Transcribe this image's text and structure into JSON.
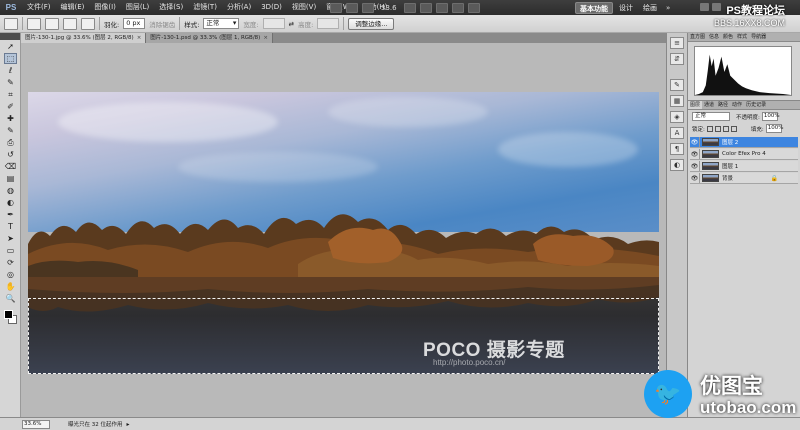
{
  "app": {
    "logo": "PS"
  },
  "menu": [
    "文件(F)",
    "编辑(E)",
    "图像(I)",
    "图层(L)",
    "选择(S)",
    "滤镜(T)",
    "分析(A)",
    "3D(D)",
    "视图(V)",
    "窗口(W)",
    "帮助(H)"
  ],
  "menubar": {
    "zoom": "33.6",
    "workspaces": [
      "基本功能",
      "设计",
      "绘画"
    ],
    "active_workspace": "基本功能",
    "more": "»"
  },
  "options": {
    "feather_label": "羽化:",
    "feather_value": "0 px",
    "antialias_label": "消除锯齿",
    "style_label": "样式:",
    "style_value": "正常",
    "width_label": "宽度:",
    "height_label": "高度:",
    "refine_button": "调整边缘..."
  },
  "doc_tabs": [
    {
      "label": "图片-130-1.jpg @ 33.6% (图层 2, RGB/8)",
      "active": true,
      "close": "×"
    },
    {
      "label": "图片-130-1.psd @ 33.3% (图层 1, RGB/8)",
      "active": false,
      "close": "×"
    }
  ],
  "tools": [
    "move-tool",
    "marquee-tool",
    "lasso-tool",
    "quick-select-tool",
    "crop-tool",
    "eyedropper-tool",
    "healing-tool",
    "brush-tool",
    "clone-stamp-tool",
    "history-brush-tool",
    "eraser-tool",
    "gradient-tool",
    "blur-tool",
    "dodge-tool",
    "pen-tool",
    "type-tool",
    "path-select-tool",
    "shape-tool",
    "3d-rotate-tool",
    "3d-orbit-tool",
    "hand-tool",
    "zoom-tool"
  ],
  "tool_glyphs": [
    "➚",
    "⬚",
    "ℓ",
    "✎",
    "⌗",
    "✐",
    "✚",
    "✎",
    "⎙",
    "↺",
    "⌫",
    "▤",
    "◍",
    "◐",
    "✒",
    "T",
    "➤",
    "▭",
    "⟳",
    "◎",
    "✋",
    "🔍"
  ],
  "active_tool": 1,
  "panel_strip_icons": [
    "≡",
    "⇵",
    "✎",
    "▦",
    "◈",
    "A",
    "¶",
    "◐"
  ],
  "histogram_panel": {
    "tabs": [
      "直方图",
      "信息",
      "颜色",
      "样式",
      "导航器"
    ],
    "active_tab": 0
  },
  "layers_panel": {
    "tabs": [
      "图层",
      "通道",
      "路径",
      "动作",
      "历史记录"
    ],
    "active_tab": 0,
    "blend_mode": "正常",
    "opacity_label": "不透明度:",
    "opacity_value": "100%",
    "lock_label": "锁定:",
    "fill_label": "填充:",
    "fill_value": "100%",
    "layers": [
      {
        "name": "图层 2",
        "selected": true,
        "visible": true,
        "eye": "👁",
        "lock": ""
      },
      {
        "name": "Color Efex Pro 4",
        "selected": false,
        "visible": true,
        "eye": "👁",
        "lock": ""
      },
      {
        "name": "图层 1",
        "selected": false,
        "visible": true,
        "eye": "👁",
        "lock": ""
      },
      {
        "name": "背景",
        "selected": false,
        "visible": true,
        "eye": "👁",
        "lock": "🔒"
      }
    ]
  },
  "status": {
    "zoom": "33.6%",
    "info": "曝光只在 32 位起作用",
    "arrow": "▸"
  },
  "canvas": {
    "watermark": "POCO 摄影专题",
    "watermark_url": "http://photo.poco.cn/"
  },
  "site_watermarks": {
    "top_line1": "PS教程论坛",
    "top_line2": "BBS.16XX8.COM",
    "bottom_cn": "优图宝",
    "bottom_url": "utobao.com",
    "bottom_icon": "🐦"
  },
  "colors": {
    "accent": "#3d85e0",
    "ui_light": "#d4d4d4",
    "ui_dark": "#3a3a3a"
  }
}
